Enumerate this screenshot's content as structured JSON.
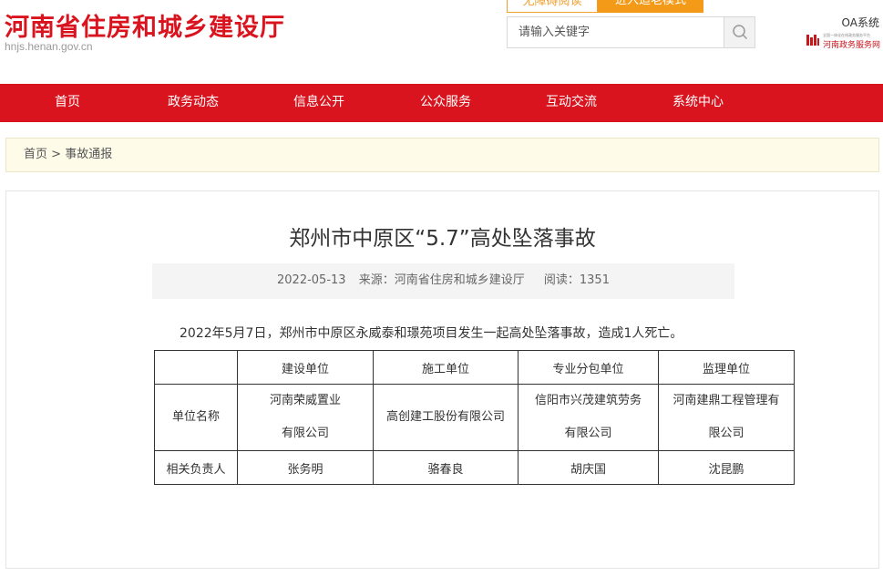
{
  "header": {
    "site_title": "河南省住房和城乡建设厅",
    "site_domain": "hnjs.henan.gov.cn",
    "accessible_label": "无障碍阅读",
    "elder_mode_label": "进入适老模式",
    "search_placeholder": "请输入关键字",
    "oa_label": "OA系统",
    "gov_logo_small": "全国一体化在线政务服务平台",
    "gov_logo_big": "河南政务服务网"
  },
  "nav": {
    "items": [
      "首页",
      "政务动态",
      "信息公开",
      "公众服务",
      "互动交流",
      "系统中心"
    ]
  },
  "breadcrumb": {
    "home": "首页",
    "sep": " > ",
    "current": "事故通报"
  },
  "article": {
    "title": "郑州市中原区“5.7”高处坠落事故",
    "date": "2022-05-13",
    "source_label": "来源：河南省住房和城乡建设厅",
    "views_label": "阅读：1351",
    "body": "2022年5月7日，郑州市中原区永威泰和璟苑项目发生一起高处坠落事故，造成1人死亡。",
    "table": {
      "headers": [
        "",
        "建设单位",
        "施工单位",
        "专业分包单位",
        "监理单位"
      ],
      "row_units": {
        "label": "单位名称",
        "cells": [
          [
            "河南荣威置业",
            "有限公司"
          ],
          [
            "高创建工股份有限公司"
          ],
          [
            "信阳市兴茂建筑劳务",
            "有限公司"
          ],
          [
            "河南建鼎工程管理有",
            "限公司"
          ]
        ]
      },
      "row_persons": {
        "label": "相关负责人",
        "cells": [
          "张务明",
          "骆春良",
          "胡庆国",
          "沈昆鹏"
        ]
      }
    }
  },
  "colors": {
    "brand_red": "#d9141f",
    "accent_orange": "#f39a18",
    "breadcrumb_bg": "#fefbe9"
  }
}
